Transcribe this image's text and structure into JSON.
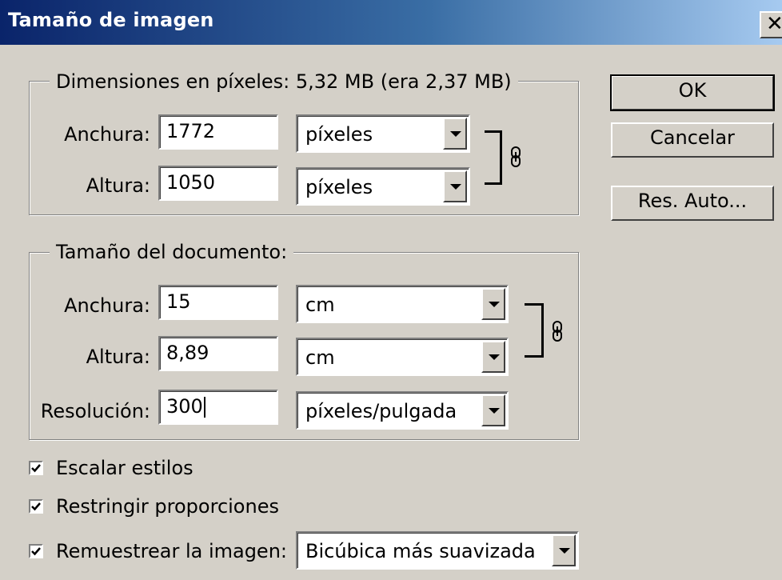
{
  "window": {
    "title": "Tamaño de imagen",
    "close_glyph": "✕"
  },
  "pixel_dimensions": {
    "legend": "Dimensiones en píxeles: 5,32 MB (era 2,37 MB)",
    "width_label": "Anchura:",
    "width_value": "1772",
    "width_unit": "píxeles",
    "height_label": "Altura:",
    "height_value": "1050",
    "height_unit": "píxeles"
  },
  "document_size": {
    "legend": "Tamaño del documento:",
    "width_label": "Anchura:",
    "width_value": "15",
    "width_unit": "cm",
    "height_label": "Altura:",
    "height_value": "8,89",
    "height_unit": "cm",
    "resolution_label": "Resolución:",
    "resolution_value": "300",
    "resolution_unit": "píxeles/pulgada"
  },
  "buttons": {
    "ok": "OK",
    "cancel": "Cancelar",
    "auto": "Res. Auto..."
  },
  "options": {
    "scale_styles": {
      "label": "Escalar estilos",
      "checked": true
    },
    "constrain": {
      "label": "Restringir proporciones",
      "checked": true
    },
    "resample": {
      "label": "Remuestrear la imagen:",
      "checked": true,
      "method": "Bicúbica más suavizada"
    }
  },
  "icons": {
    "link": "chain-link-icon",
    "dropdown": "chevron-down-icon",
    "check": "checkmark-icon"
  },
  "colors": {
    "titlebar_start": "#0a246a",
    "titlebar_end": "#a6caf0",
    "face": "#d4d0c8"
  }
}
